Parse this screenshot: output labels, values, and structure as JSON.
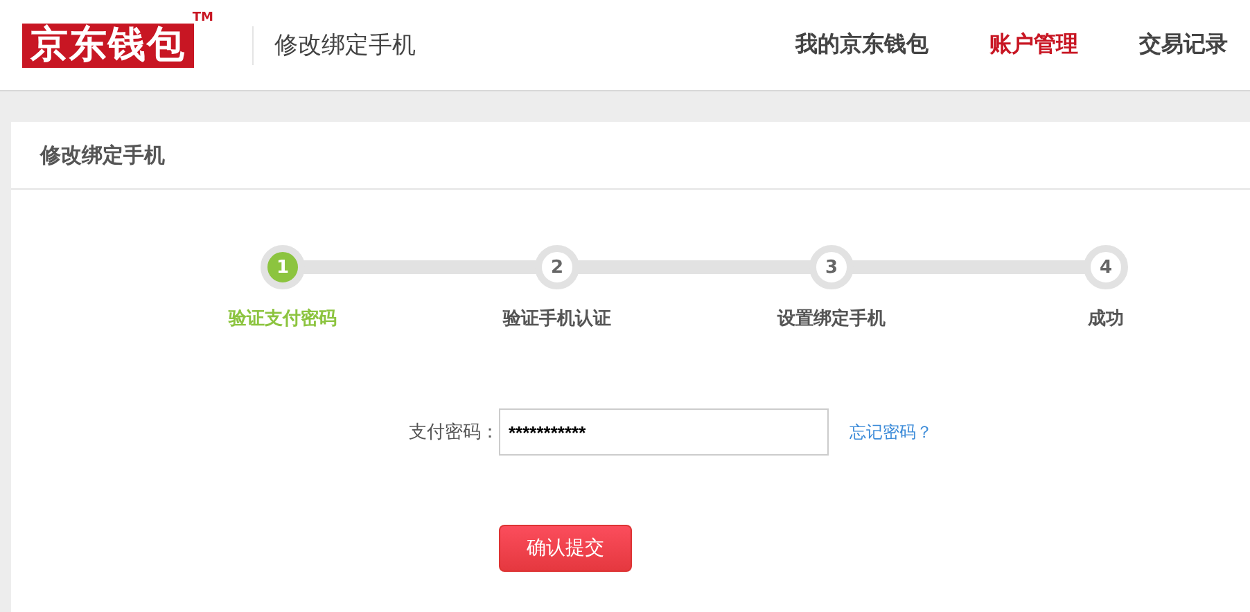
{
  "header": {
    "logo": "京东钱包",
    "trademark": "TM",
    "subtitle": "修改绑定手机",
    "nav": [
      {
        "label": "我的京东钱包",
        "selected": false
      },
      {
        "label": "账户管理",
        "selected": true
      },
      {
        "label": "交易记录",
        "selected": false
      }
    ]
  },
  "panel": {
    "title": "修改绑定手机",
    "steps": [
      {
        "number": "1",
        "label": "验证支付密码",
        "selected": true
      },
      {
        "number": "2",
        "label": "验证手机认证",
        "selected": false
      },
      {
        "number": "3",
        "label": "设置绑定手机",
        "selected": false
      },
      {
        "number": "4",
        "label": "成功",
        "selected": false
      }
    ],
    "form": {
      "label": "支付密码：",
      "value": "***********",
      "link": "忘记密码？",
      "submit": "确认提交"
    }
  }
}
